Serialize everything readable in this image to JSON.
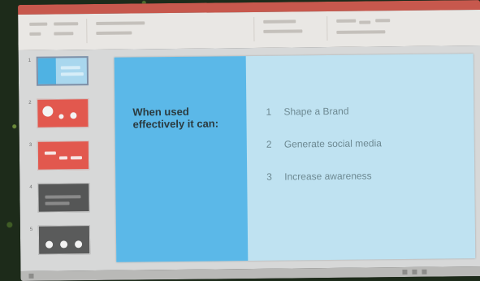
{
  "app": {
    "title_bar_text": ""
  },
  "thumbnails": [
    {
      "number": "1",
      "style": "blue"
    },
    {
      "number": "2",
      "style": "red-dots"
    },
    {
      "number": "3",
      "style": "red-bars"
    },
    {
      "number": "4",
      "style": "grey-bars"
    },
    {
      "number": "5",
      "style": "grey-dots"
    }
  ],
  "slide": {
    "heading": "When used effectively it can:",
    "items": [
      {
        "num": "1",
        "text": "Shape a Brand"
      },
      {
        "num": "2",
        "text": "Generate social media"
      },
      {
        "num": "3",
        "text": "Increase awareness"
      }
    ]
  },
  "colors": {
    "title_bar": "#c7584d",
    "slide_accent": "#5bb8e8",
    "slide_bg": "#bfe2f1",
    "thumb_red": "#e2584e",
    "thumb_grey": "#555656"
  }
}
